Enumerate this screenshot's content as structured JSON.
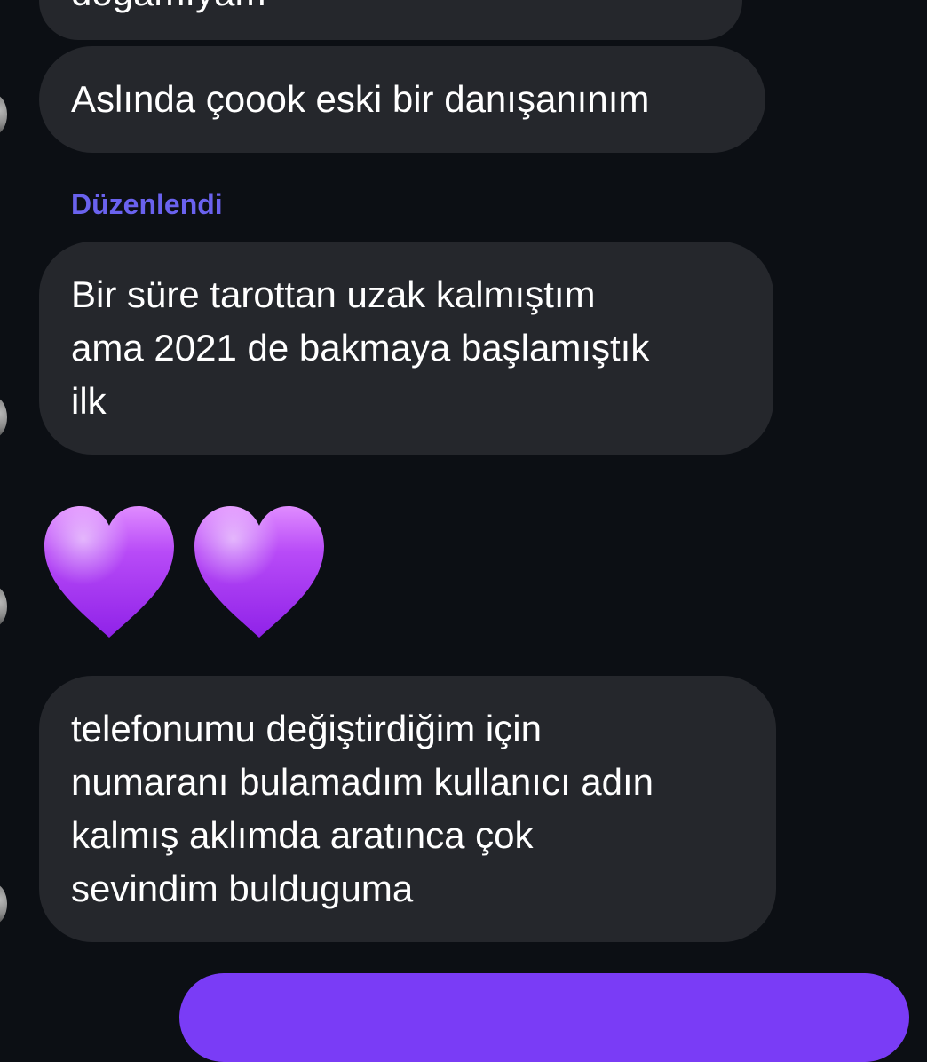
{
  "messages": {
    "partial_text": "doğamıyam",
    "msg1": "Aslında çoook eski bir danışanınım",
    "edited_label": "Düzenlendi",
    "msg2_lines": [
      "Bir süre tarottan uzak kalmıştım",
      "ama 2021 de bakmaya başlamıştık",
      "ilk"
    ],
    "emoji_hearts": [
      "💜",
      "💜"
    ],
    "msg3_lines": [
      "telefonumu değiştirdiğim için",
      "numaranı bulamadım kullanıcı adın",
      "kalmış aklımda aratınca çok",
      "sevindim bulduguma"
    ]
  },
  "colors": {
    "background": "#0c0f14",
    "incoming_bubble": "#25272c",
    "outgoing_bubble": "#7a3cf6",
    "edited_label": "#6a62ee",
    "heart": "#a236f2"
  },
  "icons": {
    "avatar": "avatar",
    "heart": "purple-heart-icon"
  }
}
